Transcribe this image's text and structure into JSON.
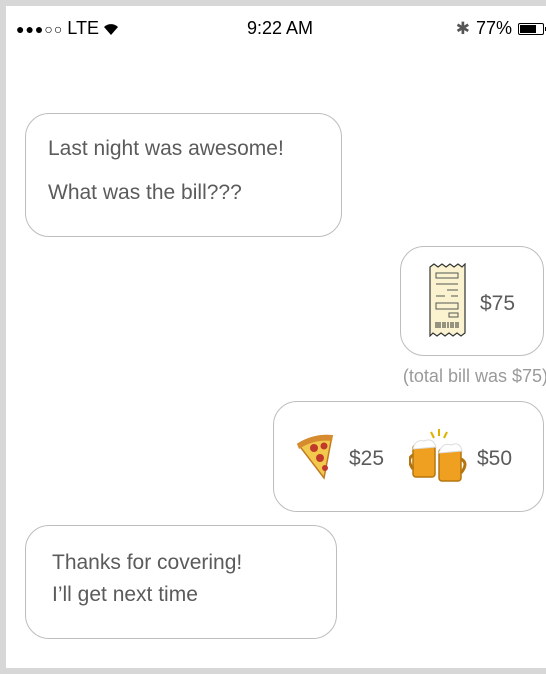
{
  "status_bar": {
    "signal": "●●●○○",
    "carrier": "LTE",
    "wifi_icon": "wifi-icon",
    "time": "9:22 AM",
    "bluetooth_icon": "bluetooth-icon",
    "battery_percent": "77%",
    "battery_level": 0.77
  },
  "messages": [
    {
      "lines": [
        "Last night was awesome!",
        "What was the bill???"
      ]
    },
    {
      "icon": "receipt-icon",
      "amount": "$75"
    },
    {
      "caption": "(total bill was $75)"
    },
    {
      "items": [
        {
          "icon": "pizza-icon",
          "amount": "$25"
        },
        {
          "icon": "beer-mugs-icon",
          "amount": "$50"
        }
      ]
    },
    {
      "lines": [
        "Thanks for covering!",
        "I’ll get next time"
      ]
    }
  ],
  "colors": {
    "bubble_border": "#bdbdbd",
    "text": "#5b5b5b",
    "caption": "#9a9a9a"
  }
}
